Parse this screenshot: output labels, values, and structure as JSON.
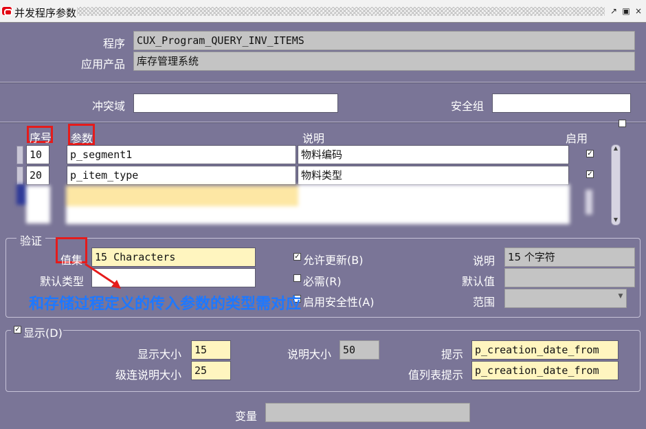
{
  "window": {
    "title": "并发程序参数",
    "controls": {
      "restore": "↗",
      "maximize": "▣",
      "close": "×"
    }
  },
  "header": {
    "program_label": "程序",
    "program_value": "CUX_Program_QUERY_INV_ITEMS",
    "app_label": "应用产品",
    "app_value": "库存管理系统"
  },
  "conflicts": {
    "conflict_domain_label": "冲突域",
    "conflict_domain_value": "",
    "security_group_label": "安全组",
    "security_group_value": ""
  },
  "params_table": {
    "col_seq": "序号",
    "col_param": "参数",
    "col_desc": "说明",
    "col_enabled": "启用",
    "rows": [
      {
        "seq": "10",
        "param": "p_segment1",
        "desc": "物料编码",
        "enabled": true
      },
      {
        "seq": "20",
        "param": "p_item_type",
        "desc": "物料类型",
        "enabled": true
      }
    ]
  },
  "validation": {
    "section_label": "验证",
    "value_set_label": "值集",
    "value_set_value": "15 Characters",
    "default_type_label": "默认类型",
    "default_type_value": "",
    "allow_update_label": "允许更新(B)",
    "allow_update_checked": true,
    "required_label": "必需(R)",
    "required_checked": false,
    "security_label": "启用安全性(A)",
    "security_checked": false,
    "desc_label": "说明",
    "desc_value": "15 个字符",
    "default_value_label": "默认值",
    "default_value_value": "",
    "range_label": "范围",
    "range_value": ""
  },
  "annotation": {
    "text": "和存储过程定义的传入参数的类型需对应",
    "color": "#1e78ff"
  },
  "display": {
    "section_label": "显示(D)",
    "checked": true,
    "display_size_label": "显示大小",
    "display_size_value": "15",
    "desc_size_label": "说明大小",
    "desc_size_value": "50",
    "prompt_label": "提示",
    "prompt_value": "p_creation_date_from",
    "concat_desc_label": "级连说明大小",
    "concat_desc_value": "25",
    "lov_prompt_label": "值列表提示",
    "lov_prompt_value": "p_creation_date_from"
  },
  "variable": {
    "label": "变量",
    "value": ""
  },
  "colors": {
    "background": "#7a7597",
    "highlight_red": "#e51b1b",
    "field_yellow": "#fff5bf",
    "field_gray": "#c4c4c4"
  }
}
